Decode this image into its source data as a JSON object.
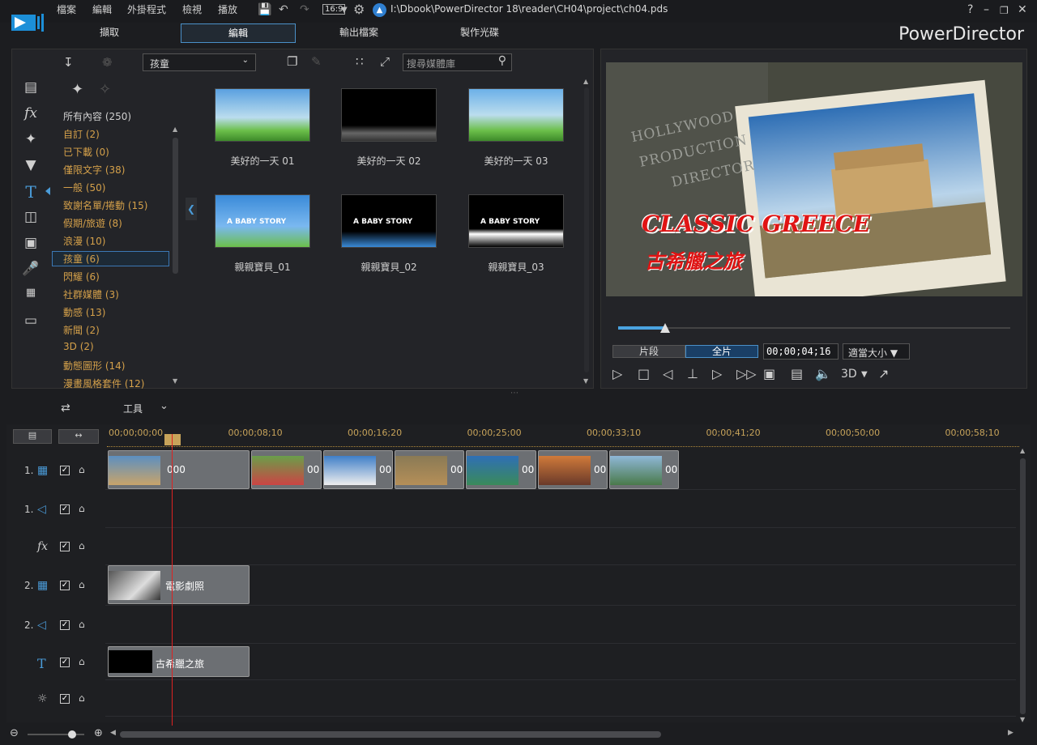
{
  "menubar": {
    "items": [
      "檔案",
      "編輯",
      "外掛程式",
      "檢視",
      "播放"
    ],
    "path": "I:\\Dbook\\PowerDirector 18\\reader\\CH04\\project\\ch04.pds",
    "aspect": "16:9",
    "help": "?"
  },
  "tabs": [
    "擷取",
    "編輯",
    "輸出檔案",
    "製作光碟"
  ],
  "brand": "PowerDirector",
  "library": {
    "dropdown": "孩童",
    "search_placeholder": "搜尋媒體庫",
    "categories": [
      "所有內容 (250)",
      "自訂  (2)",
      "已下載  (0)",
      "僅限文字  (38)",
      "一般  (50)",
      "致謝名單/捲動  (15)",
      "假期/旅遊  (8)",
      "浪漫  (10)",
      "孩童  (6)",
      "閃耀  (6)",
      "社群媒體  (3)",
      "動感  (13)",
      "新聞  (2)",
      "3D  (2)",
      "動態圖形  (14)",
      "漫畫風格套件  (12)"
    ],
    "thumbs": [
      {
        "label": "美好的一天 01"
      },
      {
        "label": "美好的一天 02"
      },
      {
        "label": "美好的一天 03"
      },
      {
        "label": "親親寶貝_01"
      },
      {
        "label": "親親寶貝_02"
      },
      {
        "label": "親親寶貝_03"
      }
    ],
    "baby_text": "A BABY STORY"
  },
  "preview": {
    "title_en": "CLASSIC GREECE",
    "title_zh": "古希臘之旅",
    "bg_words": [
      "HOLLYWOOD",
      "PRODUCTION",
      "DIRECTOR"
    ],
    "clip_btn": "片段",
    "movie_btn": "全片",
    "timecode": "00;00;04;16",
    "fit": "適當大小 ▼",
    "mode3d": "3D",
    "progress": 0.12
  },
  "timeline": {
    "tool_label": "工具",
    "ruler": [
      "00;00;00;00",
      "00;00;08;10",
      "00;00;16;20",
      "00;00;25;00",
      "00;00;33;10",
      "00;00;41;20",
      "00;00;50;00",
      "00;00;58;10"
    ],
    "tracks": [
      {
        "num": "1.",
        "kind": "video"
      },
      {
        "num": "1.",
        "kind": "audio"
      },
      {
        "num": "",
        "kind": "fx"
      },
      {
        "num": "2.",
        "kind": "video"
      },
      {
        "num": "2.",
        "kind": "audio"
      },
      {
        "num": "",
        "kind": "title"
      },
      {
        "num": "",
        "kind": "voice"
      }
    ],
    "clip_short": "00",
    "main_clip_label": "000",
    "movie_clip_label": "電影劇照",
    "title_clip_label": "古希臘之旅"
  },
  "colors": {
    "accent": "#4a90c8",
    "category": "#d4a04a",
    "ruler": "#c7a35a",
    "playhead": "#dd2222"
  }
}
